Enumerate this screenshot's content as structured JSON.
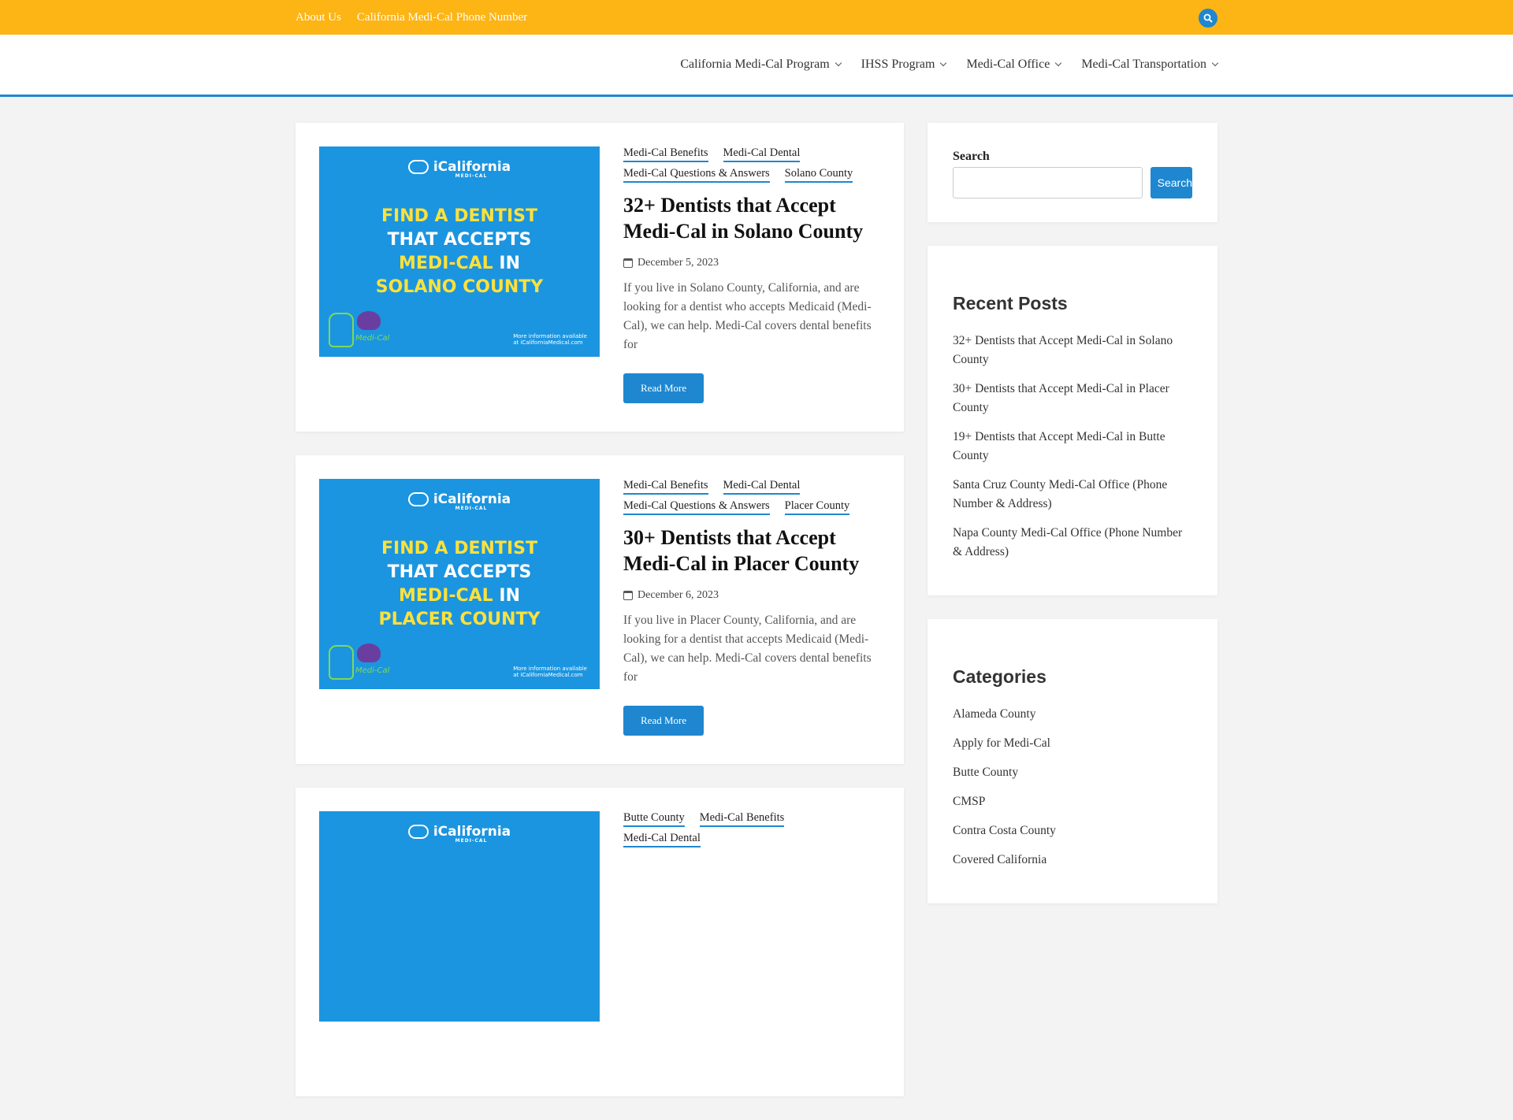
{
  "topbar": {
    "links": [
      "About Us",
      "California Medi-Cal Phone Number"
    ],
    "search_icon": "search-icon"
  },
  "nav": {
    "items": [
      "California Medi-Cal Program",
      "IHSS Program",
      "Medi-Cal Office",
      "Medi-Cal Transportation"
    ]
  },
  "colors": {
    "topbar": "#fdb415",
    "accent": "#1e87d0"
  },
  "posts": [
    {
      "categories": [
        "Medi-Cal Benefits",
        "Medi-Cal Dental",
        "Medi-Cal Questions & Answers",
        "Solano County"
      ],
      "title": "32+ Dentists that Accept Medi-Cal in Solano County",
      "date": "December 5, 2023",
      "excerpt": "If you live in Solano County, California, and are looking for a dentist who accepts Medicaid (Medi-Cal), we can help. Medi-Cal covers dental benefits for",
      "read_more": "Read More",
      "image": {
        "brand": "iCalifornia",
        "brand_sub": "MEDI-CAL",
        "line1": "FIND A DENTIST",
        "line2": "THAT ACCEPTS",
        "line3a": "MEDI-CAL",
        "line3b": " IN",
        "line4": "SOLANO COUNTY",
        "signature": "Medi-Cal",
        "more1": "More information available",
        "more2": "at iCaliforniaMedical.com"
      }
    },
    {
      "categories": [
        "Medi-Cal Benefits",
        "Medi-Cal Dental",
        "Medi-Cal Questions & Answers",
        "Placer County"
      ],
      "title": "30+ Dentists that Accept Medi-Cal in Placer County",
      "date": "December 6, 2023",
      "excerpt": "If you live in Placer County, California, and are looking for a dentist that accepts Medicaid (Medi-Cal), we can help. Medi-Cal covers dental benefits for",
      "read_more": "Read More",
      "image": {
        "brand": "iCalifornia",
        "brand_sub": "MEDI-CAL",
        "line1": "FIND A DENTIST",
        "line2": "THAT ACCEPTS",
        "line3a": "MEDI-CAL",
        "line3b": " IN",
        "line4": "PLACER COUNTY",
        "signature": "Medi-Cal",
        "more1": "More information available",
        "more2": "at iCaliforniaMedical.com"
      }
    },
    {
      "categories": [
        "Butte County",
        "Medi-Cal Benefits",
        "Medi-Cal Dental"
      ],
      "image": {
        "brand": "iCalifornia",
        "brand_sub": "MEDI-CAL"
      }
    }
  ],
  "sidebar": {
    "search_label": "Search",
    "search_button": "Search",
    "recent_title": "Recent Posts",
    "recent": [
      "32+ Dentists that Accept Medi-Cal in Solano County",
      "30+ Dentists that Accept Medi-Cal in Placer County",
      "19+ Dentists that Accept Medi-Cal in Butte County",
      "Santa Cruz County Medi-Cal Office (Phone Number & Address)",
      "Napa County Medi-Cal Office (Phone Number & Address)"
    ],
    "categories_title": "Categories",
    "categories": [
      "Alameda County",
      "Apply for Medi-Cal",
      "Butte County",
      "CMSP",
      "Contra Costa County",
      "Covered California"
    ]
  }
}
